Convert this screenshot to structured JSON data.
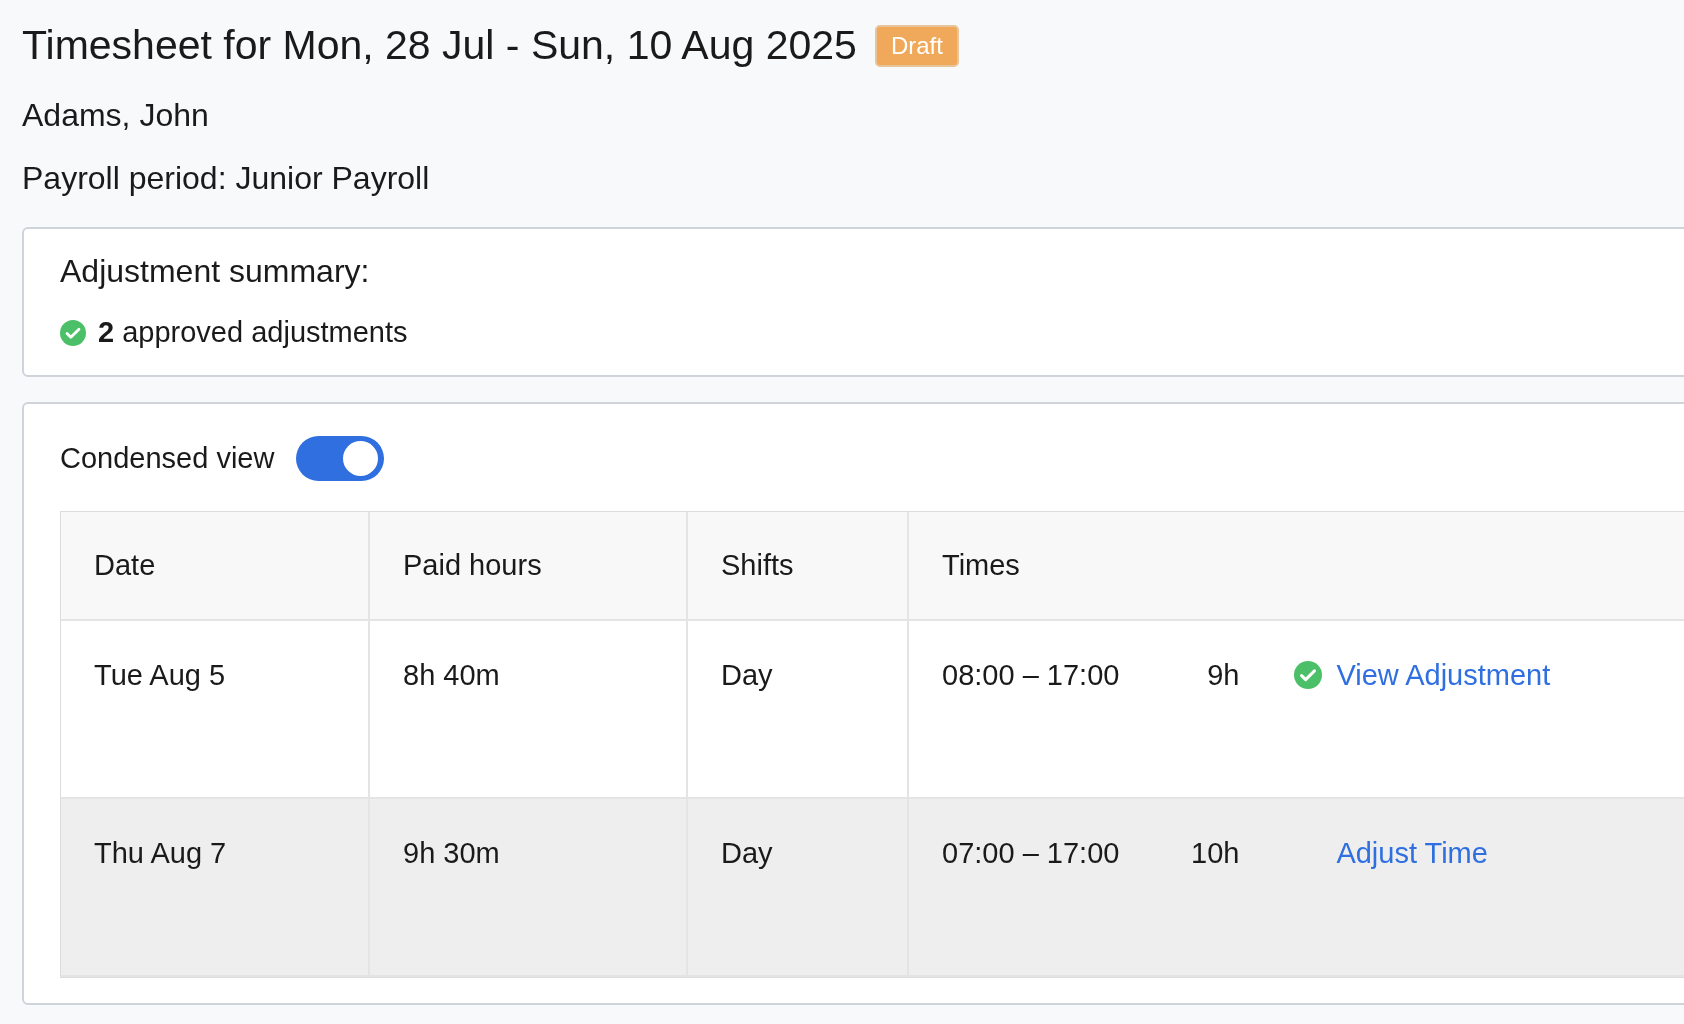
{
  "title": "Timesheet for Mon, 28 Jul - Sun, 10 Aug 2025",
  "status_badge": "Draft",
  "employee": "Adams, John",
  "payroll_period": "Payroll period: Junior Payroll",
  "adjustment_summary": {
    "heading": "Adjustment summary:",
    "text": "**2** approved adjustments"
  },
  "condensed_view": {
    "label": "Condensed view",
    "on": true
  },
  "table": {
    "columns": [
      "Date",
      "Paid hours",
      "Shifts",
      "Times"
    ],
    "rows": [
      {
        "date": "Tue Aug 5",
        "paid_hours": "8h 40m",
        "shift": "Day",
        "time_range": "08:00 – 17:00",
        "duration": "9h",
        "approved": true,
        "action": "View Adjustment",
        "highlighted": false
      },
      {
        "date": "Thu Aug 7",
        "paid_hours": "9h 30m",
        "shift": "Day",
        "time_range": "07:00 – 17:00",
        "duration": "10h",
        "approved": false,
        "action": "Adjust Time",
        "highlighted": true
      }
    ]
  }
}
